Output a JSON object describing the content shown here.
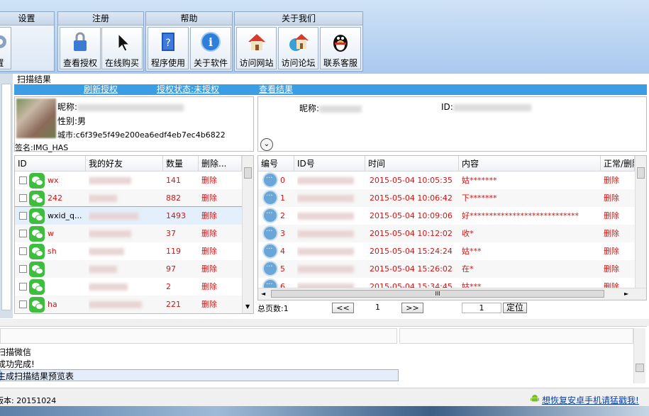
{
  "ribbon": {
    "groups": [
      {
        "title": "设置",
        "buttons": [
          {
            "label": "置",
            "icon": "settings-icon"
          }
        ]
      },
      {
        "title": "注册",
        "buttons": [
          {
            "label": "查看授权",
            "icon": "lock-icon"
          },
          {
            "label": "在线购买",
            "icon": "cursor-icon"
          }
        ]
      },
      {
        "title": "帮助",
        "buttons": [
          {
            "label": "程序使用",
            "icon": "help-book-icon"
          },
          {
            "label": "关于软件",
            "icon": "info-icon"
          }
        ]
      },
      {
        "title": "关于我们",
        "buttons": [
          {
            "label": "访问网站",
            "icon": "home-icon"
          },
          {
            "label": "访问论坛",
            "icon": "globe-house-icon"
          },
          {
            "label": "联系客服",
            "icon": "qq-penguin-icon"
          }
        ]
      }
    ]
  },
  "scan": {
    "section_label": "扫描结果",
    "links": {
      "refresh": "刷新授权",
      "auth_status": "授权状态:未授权",
      "view_result": "查看结果"
    }
  },
  "profile": {
    "nickname_label": "昵称:",
    "gender": "性别:男",
    "city": "城市:c6f39e5f49e200ea6edf4eb7ec4b6822",
    "signature": "签名:IMG_HAS"
  },
  "right_profile": {
    "nickname_label": "昵称:",
    "id_label": "ID:"
  },
  "friends": {
    "columns": [
      "ID",
      "我的好友",
      "数量",
      "删除..."
    ],
    "rows": [
      {
        "id": "wx",
        "count": "141",
        "action": "删除"
      },
      {
        "id": "242",
        "count": "882",
        "action": "删除"
      },
      {
        "id": "wxid_q...",
        "count": "1493",
        "action": "删除"
      },
      {
        "id": "w",
        "count": "37",
        "action": "删除"
      },
      {
        "id": "sh",
        "count": "119",
        "action": "删除"
      },
      {
        "id": "",
        "count": "97",
        "action": "删除"
      },
      {
        "id": "",
        "count": "2",
        "action": "删除"
      },
      {
        "id": "ha",
        "count": "221",
        "action": "删除"
      }
    ]
  },
  "messages": {
    "columns": [
      "编号",
      "ID号",
      "时间",
      "内容",
      "正常/删除"
    ],
    "rows": [
      {
        "num": "0",
        "time": "2015-05-04 10:05:35",
        "content": "姑*******",
        "action": "删除"
      },
      {
        "num": "1",
        "time": "2015-05-04 10:06:42",
        "content": "下*******",
        "action": "删除"
      },
      {
        "num": "2",
        "time": "2015-05-04 10:09:06",
        "content": "好****************************",
        "action": "删除"
      },
      {
        "num": "3",
        "time": "2015-05-04 10:12:02",
        "content": "收*",
        "action": "删除"
      },
      {
        "num": "4",
        "time": "2015-05-04 15:24:24",
        "content": "姑***",
        "action": "删除"
      },
      {
        "num": "5",
        "time": "2015-05-04 15:26:02",
        "content": "在*",
        "action": "删除"
      },
      {
        "num": "6",
        "time": "2015-05-04 15:34:45",
        "content": "姑***",
        "action": "删除"
      }
    ],
    "hscroll_thumb": "III"
  },
  "pager": {
    "total_label": "总页数:1",
    "prev": "<<",
    "page": "1",
    "next": ">>",
    "goto_value": "1",
    "locate": "定位"
  },
  "log": {
    "lines": [
      "扫描微信",
      "成功完成!",
      "生成扫描结果预览表"
    ]
  },
  "status": {
    "version": "版本: 20151024",
    "link": "想恢复安卓手机请猛戳我!"
  }
}
